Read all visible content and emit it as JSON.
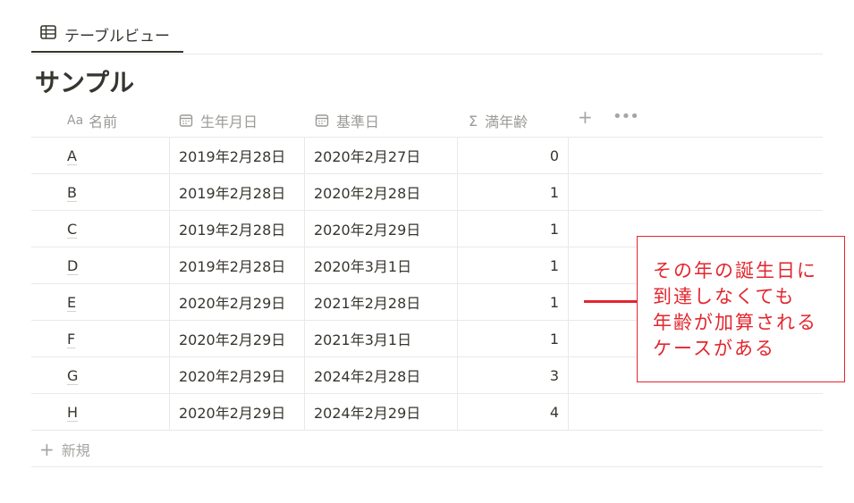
{
  "view_tab": {
    "icon": "table-icon",
    "label": "テーブルビュー"
  },
  "page_title": "サンプル",
  "columns": {
    "name": {
      "icon": "text-type-icon",
      "icon_text": "Aa",
      "label": "名前"
    },
    "birth": {
      "icon": "calendar-icon",
      "label": "生年月日"
    },
    "base": {
      "icon": "calendar-icon",
      "label": "基準日"
    },
    "age": {
      "icon": "sigma-formula-icon",
      "icon_text": "Σ",
      "label": "満年齢"
    },
    "add_icon": "+",
    "more_icon": "•••"
  },
  "rows": [
    {
      "name": "A",
      "birth": "2019年2月28日",
      "base": "2020年2月27日",
      "age": "0"
    },
    {
      "name": "B",
      "birth": "2019年2月28日",
      "base": "2020年2月28日",
      "age": "1"
    },
    {
      "name": "C",
      "birth": "2019年2月28日",
      "base": "2020年2月29日",
      "age": "1"
    },
    {
      "name": "D",
      "birth": "2019年2月28日",
      "base": "2020年3月1日",
      "age": "1"
    },
    {
      "name": "E",
      "birth": "2020年2月29日",
      "base": "2021年2月28日",
      "age": "1"
    },
    {
      "name": "F",
      "birth": "2020年2月29日",
      "base": "2021年3月1日",
      "age": "1"
    },
    {
      "name": "G",
      "birth": "2020年2月29日",
      "base": "2024年2月28日",
      "age": "3"
    },
    {
      "name": "H",
      "birth": "2020年2月29日",
      "base": "2024年2月29日",
      "age": "4"
    }
  ],
  "new_row": {
    "icon": "+",
    "label": "新規"
  },
  "annotation": {
    "color": "#e3262e",
    "lines": [
      "その年の誕生日に",
      "到達しなくても",
      "年齢が加算される",
      "ケースがある"
    ]
  }
}
